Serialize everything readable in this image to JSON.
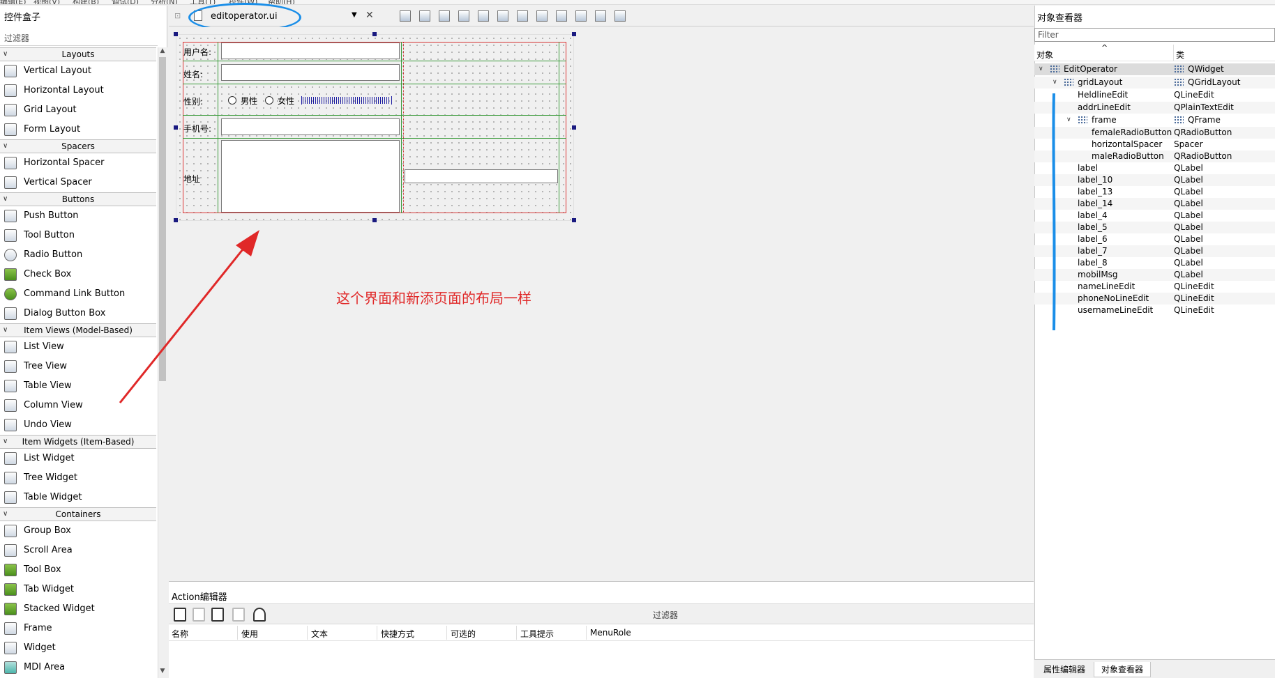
{
  "menubar": [
    "编辑(E)",
    "视图(V)",
    "构建(B)",
    "调试(D)",
    "分析(N)",
    "工具(T)",
    "控件(W)",
    "帮助(H)"
  ],
  "widget_box": {
    "title": "控件盒子",
    "filter": "过滤器",
    "categories": [
      {
        "label": "Layouts",
        "items": [
          "Vertical Layout",
          "Horizontal Layout",
          "Grid Layout",
          "Form Layout"
        ]
      },
      {
        "label": "Spacers",
        "items": [
          "Horizontal Spacer",
          "Vertical Spacer"
        ]
      },
      {
        "label": "Buttons",
        "items": [
          "Push Button",
          "Tool Button",
          "Radio Button",
          "Check Box",
          "Command Link Button",
          "Dialog Button Box"
        ]
      },
      {
        "label": "Item Views (Model-Based)",
        "items": [
          "List View",
          "Tree View",
          "Table View",
          "Column View",
          "Undo View"
        ]
      },
      {
        "label": "Item Widgets (Item-Based)",
        "items": [
          "List Widget",
          "Tree Widget",
          "Table Widget"
        ]
      },
      {
        "label": "Containers",
        "items": [
          "Group Box",
          "Scroll Area",
          "Tool Box",
          "Tab Widget",
          "Stacked Widget",
          "Frame",
          "Widget",
          "MDI Area"
        ]
      }
    ]
  },
  "editor": {
    "file_name": "editoperator.ui",
    "form": {
      "username_label": "用户名:",
      "name_label": "姓名:",
      "gender_label": "性别:",
      "male_label": "男性",
      "female_label": "女性",
      "phone_label": "手机号:",
      "address_label": "地址"
    },
    "annotation": "这个界面和新添页面的布局一样"
  },
  "action_editor": {
    "title": "Action编辑器",
    "filter": "过滤器",
    "columns": [
      "名称",
      "使用",
      "文本",
      "快捷方式",
      "可选的",
      "工具提示",
      "MenuRole"
    ]
  },
  "object_inspector": {
    "title": "对象查看器",
    "filter_placeholder": "Filter",
    "col_object": "对象",
    "col_class": "类",
    "rows": [
      {
        "name": "EditOperator",
        "cls": "QWidget",
        "level": 0,
        "expander": "v",
        "icon": true
      },
      {
        "name": "gridLayout",
        "cls": "QGridLayout",
        "level": 1,
        "expander": "v",
        "icon": true
      },
      {
        "name": "HeldlineEdit",
        "cls": "QLineEdit",
        "level": 2
      },
      {
        "name": "addrLineEdit",
        "cls": "QPlainTextEdit",
        "level": 2
      },
      {
        "name": "frame",
        "cls": "QFrame",
        "level": 2,
        "expander": "v",
        "icon": true
      },
      {
        "name": "femaleRadioButton",
        "cls": "QRadioButton",
        "level": 3
      },
      {
        "name": "horizontalSpacer",
        "cls": "Spacer",
        "level": 3
      },
      {
        "name": "maleRadioButton",
        "cls": "QRadioButton",
        "level": 3
      },
      {
        "name": "label",
        "cls": "QLabel",
        "level": 2
      },
      {
        "name": "label_10",
        "cls": "QLabel",
        "level": 2
      },
      {
        "name": "label_13",
        "cls": "QLabel",
        "level": 2
      },
      {
        "name": "label_14",
        "cls": "QLabel",
        "level": 2
      },
      {
        "name": "label_4",
        "cls": "QLabel",
        "level": 2
      },
      {
        "name": "label_5",
        "cls": "QLabel",
        "level": 2
      },
      {
        "name": "label_6",
        "cls": "QLabel",
        "level": 2
      },
      {
        "name": "label_7",
        "cls": "QLabel",
        "level": 2
      },
      {
        "name": "label_8",
        "cls": "QLabel",
        "level": 2
      },
      {
        "name": "mobilMsg",
        "cls": "QLabel",
        "level": 2
      },
      {
        "name": "nameLineEdit",
        "cls": "QLineEdit",
        "level": 2
      },
      {
        "name": "phoneNoLineEdit",
        "cls": "QLineEdit",
        "level": 2
      },
      {
        "name": "usernameLineEdit",
        "cls": "QLineEdit",
        "level": 2
      }
    ],
    "tabs": [
      "属性编辑器",
      "对象查看器"
    ]
  },
  "colors": {
    "annotation_blue": "#1a8ee8",
    "annotation_red": "#e02828",
    "grid_green": "#3a9a3a",
    "grid_red": "#d33333"
  }
}
